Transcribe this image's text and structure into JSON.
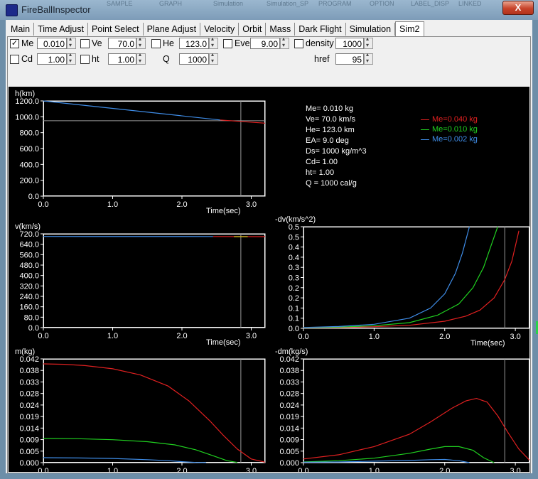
{
  "window": {
    "title": "FireBallInspector",
    "close_label": "X",
    "ghost_menu": [
      "SAMPLE",
      "GRAPH",
      "Simulation",
      "Simulation_SP",
      "PROGRAM",
      "OPTION",
      "LABEL_DISP",
      "LINKED"
    ]
  },
  "tabs": [
    {
      "label": "Main"
    },
    {
      "label": "Time Adjust"
    },
    {
      "label": "Point Select"
    },
    {
      "label": "Plane Adjust"
    },
    {
      "label": "Velocity"
    },
    {
      "label": "Orbit"
    },
    {
      "label": "Mass"
    },
    {
      "label": "Dark Flight"
    },
    {
      "label": "Simulation"
    },
    {
      "label": "Sim2"
    }
  ],
  "active_tab": "Sim2",
  "controls": {
    "me": {
      "label": "Me",
      "checked": "✓",
      "value": "0.010"
    },
    "ve": {
      "label": "Ve",
      "checked": "",
      "value": "70.0"
    },
    "he": {
      "label": "He",
      "checked": "",
      "value": "123.0"
    },
    "eve": {
      "label": "Eve",
      "checked": "",
      "value": "9.00"
    },
    "density": {
      "label": "density",
      "checked": "",
      "value": "1000"
    },
    "cd": {
      "label": "Cd",
      "checked": "",
      "value": "1.00"
    },
    "ht": {
      "label": "ht",
      "checked": "",
      "value": "1.00"
    },
    "q": {
      "label": "Q",
      "value": "1000"
    },
    "href": {
      "label": "href",
      "value": "95"
    }
  },
  "params_text": [
    "Me= 0.010 kg",
    "Ve= 70.0 km/s",
    "He= 123.0 km",
    "EA= 9.0 deg",
    "Ds= 1000 kg/m^3",
    "Cd= 1.00",
    "ht= 1.00",
    "Q = 1000 cal/g"
  ],
  "legend": [
    {
      "label": "Me=0.040 kg",
      "color": "#e02020"
    },
    {
      "label": "Me=0.010 kg",
      "color": "#20d020"
    },
    {
      "label": "Me=0.002 kg",
      "color": "#3f8de8"
    }
  ],
  "colors": {
    "red": "#e02020",
    "green": "#20d020",
    "blue": "#3f8de8",
    "axis_bg": "#000000",
    "plot_bg": "#000000"
  },
  "chart_data": [
    {
      "type": "line",
      "title": "h(km)",
      "xlabel": "Time(sec)",
      "ylim": [
        0,
        1200
      ],
      "xlim": [
        0,
        3.2
      ],
      "yticks": [
        "0.0",
        "200.0",
        "400.0",
        "600.0",
        "800.0",
        "1000.0",
        "1200.0"
      ],
      "xticks": [
        "0.0",
        "1.0",
        "2.0",
        "3.0"
      ],
      "cursor_x": 2.85,
      "ref_y": 95,
      "series": [
        {
          "name": "Me=0.040 kg",
          "color": "#e02020",
          "x": [
            2.55,
            3.2
          ],
          "y": [
            960,
            920
          ]
        },
        {
          "name": "Me=0.002 kg",
          "color": "#3f8de8",
          "x": [
            0.0,
            2.55
          ],
          "y": [
            1230,
            960
          ]
        }
      ]
    },
    {
      "type": "line",
      "title": "v(km/s)",
      "xlabel": "Time(sec)",
      "ylim": [
        0,
        720
      ],
      "xlim": [
        0,
        3.2
      ],
      "yticks": [
        "0.0",
        "80.0",
        "160.0",
        "240.0",
        "320.0",
        "400.0",
        "480.0",
        "560.0",
        "640.0",
        "720.0"
      ],
      "xticks": [
        "0.0",
        "1.0",
        "2.0",
        "3.0"
      ],
      "cursor_x": 2.85,
      "series": [
        {
          "name": "Me=0.002 kg",
          "color": "#3f8de8",
          "x": [
            0.0,
            2.45
          ],
          "y": [
            700,
            699
          ]
        },
        {
          "name": "Me=0.040 kg",
          "color": "#e02020",
          "x": [
            2.45,
            3.2
          ],
          "y": [
            699,
            698
          ]
        },
        {
          "name": "Me=0.010 kg",
          "color": "#d8c820",
          "x": [
            2.75,
            2.95
          ],
          "y": [
            698,
            698
          ]
        }
      ]
    },
    {
      "type": "line",
      "title": "-dv(km/s^2)",
      "xlabel": "Time(sec)",
      "ylim": [
        0,
        0.5
      ],
      "xlim": [
        0,
        3.2
      ],
      "yticks": [
        "0.0",
        "0.1",
        "0.1",
        "0.2",
        "0.2",
        "0.3",
        "0.3",
        "0.4",
        "0.4",
        "0.5",
        "0.5"
      ],
      "xticks": [
        "0.0",
        "1.0",
        "2.0",
        "3.0"
      ],
      "cursor_x": 2.85,
      "series": [
        {
          "name": "Me=0.040 kg",
          "color": "#e02020",
          "x": [
            0.0,
            0.5,
            1.0,
            1.5,
            2.0,
            2.3,
            2.5,
            2.7,
            2.85,
            2.95,
            3.05
          ],
          "y": [
            0.002,
            0.004,
            0.008,
            0.015,
            0.035,
            0.06,
            0.09,
            0.15,
            0.24,
            0.33,
            0.48
          ]
        },
        {
          "name": "Me=0.010 kg",
          "color": "#20d020",
          "x": [
            0.0,
            0.5,
            1.0,
            1.5,
            1.9,
            2.2,
            2.4,
            2.55,
            2.65,
            2.75
          ],
          "y": [
            0.003,
            0.006,
            0.013,
            0.028,
            0.065,
            0.12,
            0.2,
            0.3,
            0.4,
            0.5
          ]
        },
        {
          "name": "Me=0.002 kg",
          "color": "#3f8de8",
          "x": [
            0.0,
            0.5,
            1.0,
            1.5,
            1.8,
            2.0,
            2.15,
            2.25,
            2.35
          ],
          "y": [
            0.004,
            0.009,
            0.02,
            0.05,
            0.1,
            0.17,
            0.27,
            0.37,
            0.5
          ]
        }
      ]
    },
    {
      "type": "line",
      "title": "m(kg)",
      "xlabel": "Time(sec)",
      "ylim": [
        0,
        0.042
      ],
      "xlim": [
        0,
        3.2
      ],
      "yticks": [
        "0.000",
        "0.005",
        "0.009",
        "0.014",
        "0.019",
        "0.024",
        "0.028",
        "0.033",
        "0.038",
        "0.042"
      ],
      "xticks": [
        "0.0",
        "1.0",
        "2.0",
        "3.0"
      ],
      "cursor_x": 2.85,
      "series": [
        {
          "name": "Me=0.040 kg",
          "color": "#e02020",
          "x": [
            0.0,
            0.3,
            0.6,
            1.0,
            1.4,
            1.8,
            2.1,
            2.4,
            2.6,
            2.8,
            3.0,
            3.2
          ],
          "y": [
            0.04,
            0.0398,
            0.0393,
            0.038,
            0.0355,
            0.031,
            0.025,
            0.017,
            0.011,
            0.0055,
            0.0015,
            0.0002
          ]
        },
        {
          "name": "Me=0.010 kg",
          "color": "#20d020",
          "x": [
            0.0,
            0.5,
            1.0,
            1.5,
            1.9,
            2.2,
            2.45,
            2.65,
            2.8
          ],
          "y": [
            0.0098,
            0.0097,
            0.0093,
            0.0085,
            0.0072,
            0.0052,
            0.0028,
            0.0008,
            0.0001
          ]
        },
        {
          "name": "Me=0.002 kg",
          "color": "#3f8de8",
          "x": [
            0.0,
            0.5,
            1.0,
            1.5,
            1.8,
            2.0,
            2.2,
            2.35
          ],
          "y": [
            0.002,
            0.0019,
            0.0017,
            0.0012,
            0.0008,
            0.0004,
            0.0001,
            0.0
          ]
        }
      ]
    },
    {
      "type": "line",
      "title": "-dm(kg/s)",
      "xlabel": "Time(sec)",
      "ylim": [
        0,
        0.042
      ],
      "xlim": [
        0,
        3.2
      ],
      "yticks": [
        "0.000",
        "0.005",
        "0.009",
        "0.014",
        "0.019",
        "0.024",
        "0.028",
        "0.033",
        "0.038",
        "0.042"
      ],
      "xticks": [
        "0.0",
        "1.0",
        "2.0",
        "3.0"
      ],
      "cursor_x": 2.85,
      "series": [
        {
          "name": "Me=0.040 kg",
          "color": "#e02020",
          "x": [
            0.0,
            0.5,
            1.0,
            1.5,
            1.8,
            2.1,
            2.3,
            2.45,
            2.6,
            2.75,
            2.9,
            3.05,
            3.2
          ],
          "y": [
            0.0015,
            0.0032,
            0.0065,
            0.0115,
            0.0165,
            0.022,
            0.025,
            0.026,
            0.0245,
            0.019,
            0.012,
            0.0055,
            0.001
          ]
        },
        {
          "name": "Me=0.010 kg",
          "color": "#20d020",
          "x": [
            0.0,
            0.5,
            1.0,
            1.5,
            1.8,
            2.0,
            2.2,
            2.4,
            2.55,
            2.7
          ],
          "y": [
            0.0003,
            0.0008,
            0.0018,
            0.0038,
            0.0055,
            0.0065,
            0.0065,
            0.005,
            0.002,
            0.0
          ]
        },
        {
          "name": "Me=0.002 kg",
          "color": "#3f8de8",
          "x": [
            0.0,
            0.5,
            1.0,
            1.5,
            1.8,
            2.0,
            2.2,
            2.35
          ],
          "y": [
            0.0002,
            0.0003,
            0.0006,
            0.0009,
            0.0012,
            0.0013,
            0.0008,
            0.0
          ]
        }
      ]
    }
  ]
}
